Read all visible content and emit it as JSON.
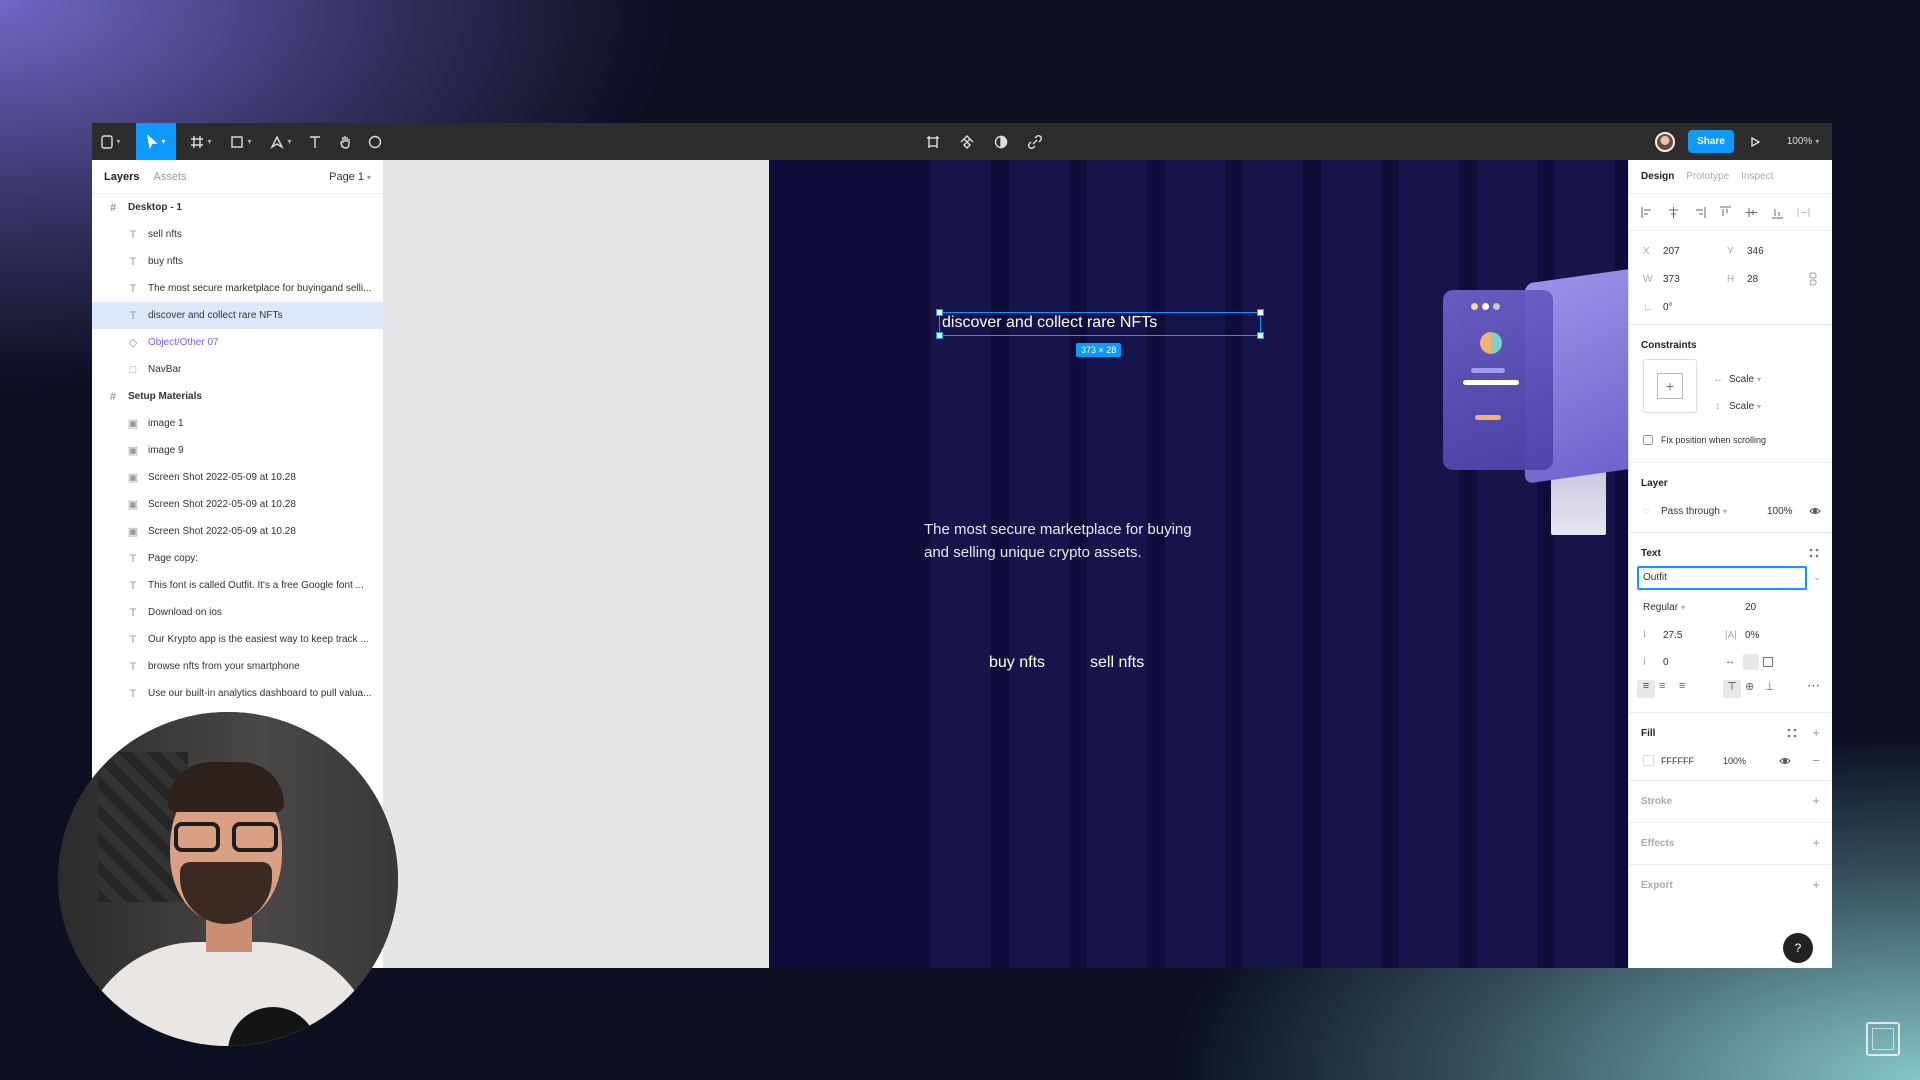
{
  "toolbar": {
    "share_label": "Share",
    "zoom": "100%"
  },
  "left_panel": {
    "tabs": [
      "Layers",
      "Assets"
    ],
    "page": "Page 1",
    "layers": [
      {
        "name": "Desktop - 1",
        "type": "frame"
      },
      {
        "name": "sell nfts",
        "type": "text"
      },
      {
        "name": "buy nfts",
        "type": "text"
      },
      {
        "name": "The most secure marketplace for buyingand selli...",
        "type": "text"
      },
      {
        "name": "discover and collect rare NFTs",
        "type": "text"
      },
      {
        "name": "Object/Other 07",
        "type": "component"
      },
      {
        "name": "NavBar",
        "type": "rect"
      },
      {
        "name": "Setup Materials",
        "type": "frame"
      },
      {
        "name": "image 1",
        "type": "image"
      },
      {
        "name": "image 9",
        "type": "image"
      },
      {
        "name": "Screen Shot 2022-05-09 at 10.28",
        "type": "image"
      },
      {
        "name": "Screen Shot 2022-05-09 at 10.28",
        "type": "image"
      },
      {
        "name": "Screen Shot 2022-05-09 at 10.28",
        "type": "image"
      },
      {
        "name": "Page copy:",
        "type": "text"
      },
      {
        "name": "This font is called Outfit. It's a free Google font ...",
        "type": "text"
      },
      {
        "name": "Download on ios",
        "type": "text"
      },
      {
        "name": "Our Krypto app is the easiest way to keep track ...",
        "type": "text"
      },
      {
        "name": "browse nfts from your smartphone",
        "type": "text"
      },
      {
        "name": "Use our built-in analytics dashboard to pull valua...",
        "type": "text"
      }
    ]
  },
  "canvas": {
    "headline": "discover and collect rare NFTs",
    "size_badge": "373 × 28",
    "subtitle_line1": "The most secure marketplace for buying",
    "subtitle_line2": "and selling unique crypto assets.",
    "buy": "buy nfts",
    "sell": "sell nfts"
  },
  "right_panel": {
    "tabs": [
      "Design",
      "Prototype",
      "Inspect"
    ],
    "x_label": "X",
    "x": "207",
    "y_label": "Y",
    "y": "346",
    "w_label": "W",
    "w": "373",
    "h_label": "H",
    "h": "28",
    "rotation": "0°",
    "constraints_title": "Constraints",
    "constraint_h": "Scale",
    "constraint_v": "Scale",
    "fix_position": "Fix position when scrolling",
    "layer_title": "Layer",
    "blend": "Pass through",
    "layer_opacity": "100%",
    "text_title": "Text",
    "font_input": "Outfit",
    "font_style": "Regular",
    "font_size": "20",
    "line_height": "27.5",
    "letter_spacing": "0%",
    "paragraph_spacing": "0",
    "fill_title": "Fill",
    "fill_hex": "FFFFFF",
    "fill_opacity": "100%",
    "stroke_title": "Stroke",
    "effects_title": "Effects",
    "export_title": "Export",
    "help": "?"
  },
  "colors": {
    "accent": "#0d99ff",
    "canvas_bg": "#0e0c3a",
    "canvas_stripe": "#17144b"
  }
}
